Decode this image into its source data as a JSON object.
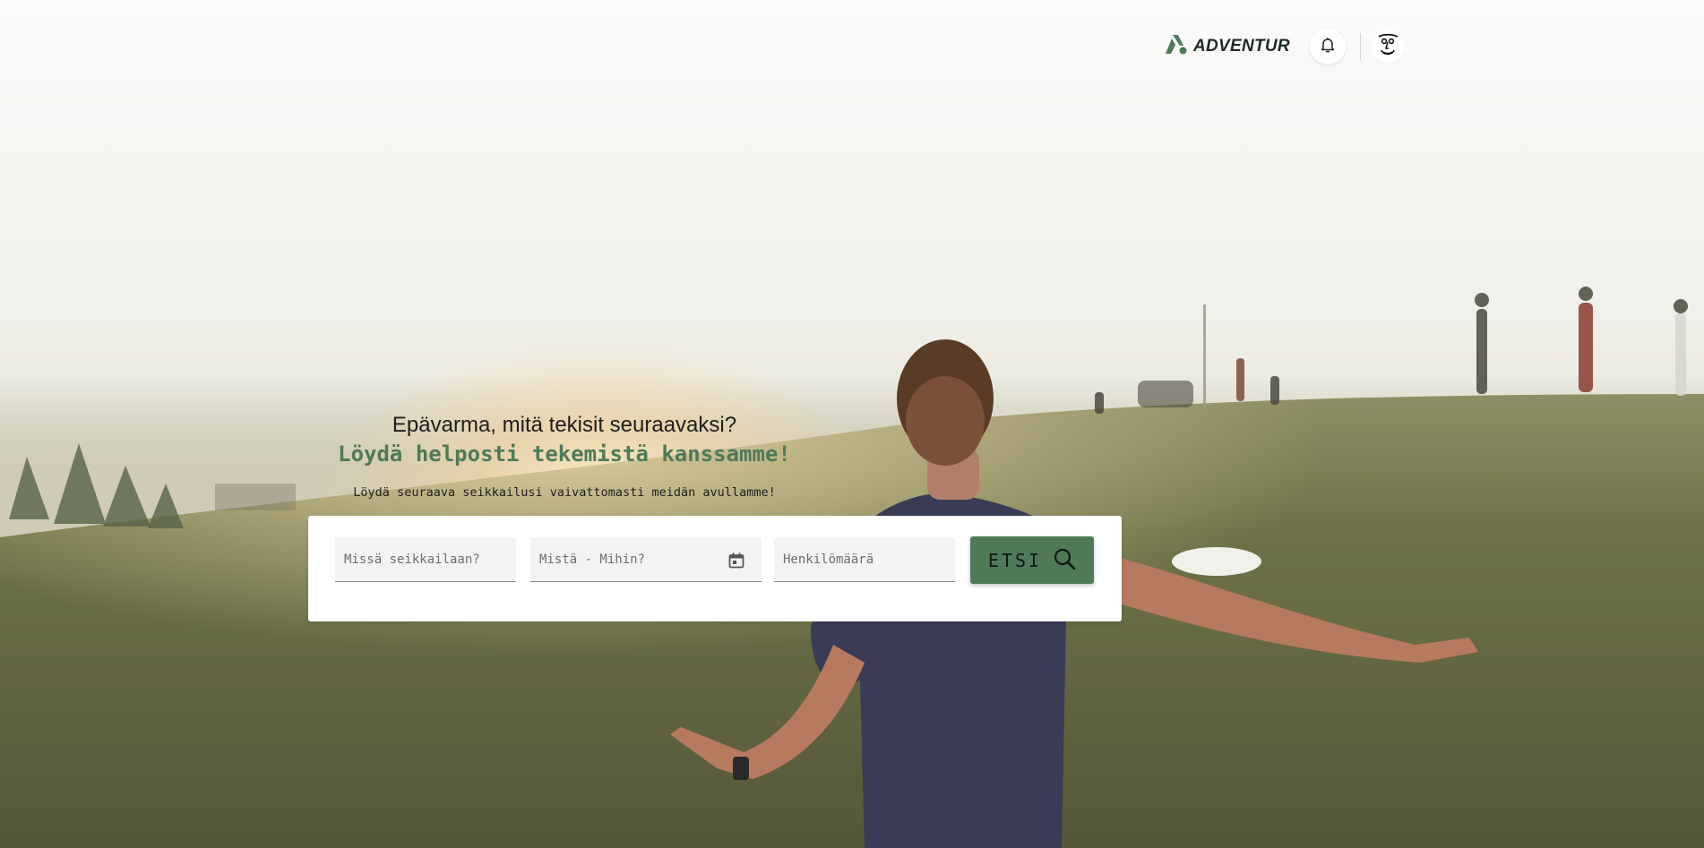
{
  "header": {
    "brand_name": "ADVENTUR",
    "icons": {
      "logo": "adventur-logo-icon",
      "notifications": "bell-icon",
      "profile": "face-avatar-icon"
    },
    "brand_color": "#4e7a58"
  },
  "hero": {
    "question": "Epävarma, mitä tekisit seuraavaksi?",
    "tagline": "Löydä helposti tekemistä kanssamme!",
    "subtitle": "Löydä seuraava seikkailusi vaivattomasti meidän avullamme!"
  },
  "search": {
    "where_placeholder": "Missä seikkailaan?",
    "dates_placeholder": "Mistä - Mihin?",
    "people_placeholder": "Henkilömäärä",
    "button_label": "ETSI",
    "icons": {
      "calendar": "calendar-icon",
      "search": "search-icon"
    },
    "accent_color": "#4e7a58"
  }
}
